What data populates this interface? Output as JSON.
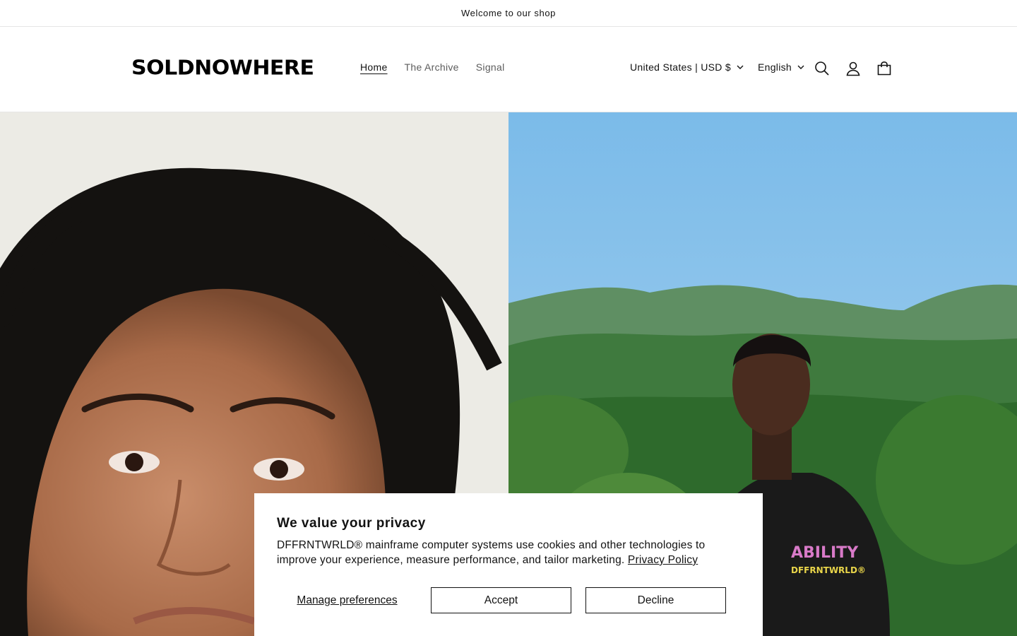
{
  "announcement": {
    "text": "Welcome to our shop"
  },
  "header": {
    "logo": "SOLDNOWHERE",
    "nav": [
      {
        "label": "Home",
        "active": true
      },
      {
        "label": "The Archive",
        "active": false
      },
      {
        "label": "Signal",
        "active": false
      }
    ],
    "country_selector": "United States | USD $",
    "language_selector": "English",
    "icons": [
      "search-icon",
      "account-icon",
      "cart-icon"
    ]
  },
  "hero": {
    "left_image": "portrait-woman-curly-hair",
    "right_image": "man-black-tshirt-tropical-hills",
    "tshirt_print": [
      "ABILITY",
      "DFFRNTWRLD®"
    ]
  },
  "cookie_banner": {
    "title": "We value your privacy",
    "body": "DFFRNTWRLD® mainframe computer systems use cookies and other technologies to improve your experience, measure performance, and tailor marketing.",
    "policy_link": "Privacy Policy",
    "manage_label": "Manage preferences",
    "accept_label": "Accept",
    "decline_label": "Decline"
  }
}
